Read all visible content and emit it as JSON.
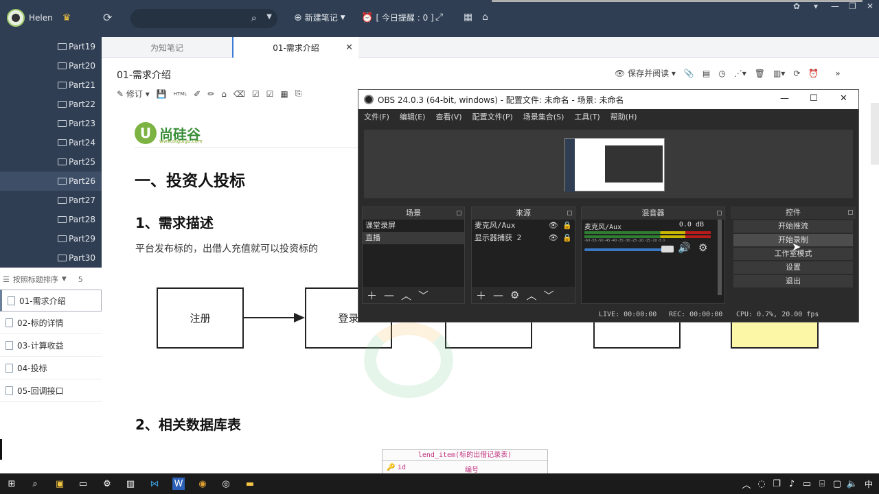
{
  "topbar": {
    "user_name": "Helen",
    "new_note": "新建笔记",
    "reminder": "[ 今日提醒 : 0 ]"
  },
  "sidebar": {
    "parts": [
      "Part19",
      "Part20",
      "Part21",
      "Part22",
      "Part23",
      "Part24",
      "Part25",
      "Part26",
      "Part27",
      "Part28",
      "Part29",
      "Part30"
    ],
    "selected_part": "Part26",
    "sort_label": "按照标题排序",
    "sort_count": "5",
    "docs": [
      "01-需求介绍",
      "02-标的详情",
      "03-计算收益",
      "04-投标",
      "05-回调接口"
    ]
  },
  "tabs": [
    "为知笔记",
    "01-需求介绍"
  ],
  "editor": {
    "doc_title": "01-需求介绍",
    "save_read": "保存并阅读",
    "revise": "修订",
    "html_label": "HTML",
    "logo_text": "尚硅谷",
    "logo_url": "www.atguigu.com",
    "h1": "一、投资人投标",
    "h2a": "1、需求描述",
    "para": "平台发布标的，出借人充值就可以投资标的",
    "flow": [
      "注册",
      "登录"
    ],
    "h2b": "2、相关数据库表",
    "table_title": "lend_item(标的出借记录表)",
    "table_col1": "id",
    "table_col2": "编号"
  },
  "obs": {
    "title": "OBS 24.0.3 (64-bit, windows) - 配置文件: 未命名 - 场景: 未命名",
    "menu": [
      "文件(F)",
      "编辑(E)",
      "查看(V)",
      "配置文件(P)",
      "场景集合(S)",
      "工具(T)",
      "帮助(H)"
    ],
    "docks": {
      "scenes": "场景",
      "sources": "来源",
      "mixer": "混音器",
      "controls": "控件"
    },
    "scenes": [
      "课堂录屏",
      "直播"
    ],
    "sources": [
      "麦克风/Aux",
      "显示器捕获 2"
    ],
    "mixer_name": "麦克风/Aux",
    "mixer_db": "0.0 dB",
    "meter_ticks": "-60 -55 -50 -45 -40 -35 -30 -25 -20 -15 -10 -5 0",
    "controls": [
      "开始推流",
      "开始录制",
      "工作室模式",
      "设置",
      "退出"
    ],
    "status": {
      "live": "LIVE: 00:00:00",
      "rec": "REC: 00:00:00",
      "cpu": "CPU: 0.7%, 20.00 fps"
    },
    "volume_level": 0.9
  },
  "taskbar": {
    "ime": "中"
  },
  "colors": {
    "sidebar_bg": "#2f3e52",
    "obs_bg": "#2b2b2b",
    "accent": "#3a7bd5"
  }
}
